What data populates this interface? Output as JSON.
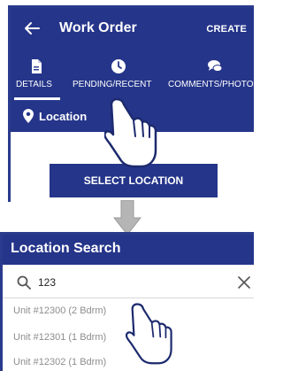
{
  "work_order": {
    "title": "Work Order",
    "create_label": "CREATE",
    "tabs": [
      {
        "label": "DETAILS",
        "icon": "document-icon",
        "active": true
      },
      {
        "label": "PENDING/RECENT",
        "icon": "clock-icon",
        "active": false
      },
      {
        "label": "COMMENTS/PHOTO",
        "icon": "chat-icon",
        "active": false
      }
    ],
    "location_label": "Location",
    "select_location_label": "SELECT LOCATION"
  },
  "location_search": {
    "title": "Location Search",
    "search_value": "123",
    "results": [
      "Unit #12300 (2 Bdrm)",
      "Unit #12301 (1 Bdrm)",
      "Unit #12302 (1 Bdrm)"
    ]
  },
  "colors": {
    "primary": "#25358a",
    "panel_border": "#2a3a8c",
    "result_text": "#8d8d8d",
    "arrow": "#b5b5b5"
  }
}
